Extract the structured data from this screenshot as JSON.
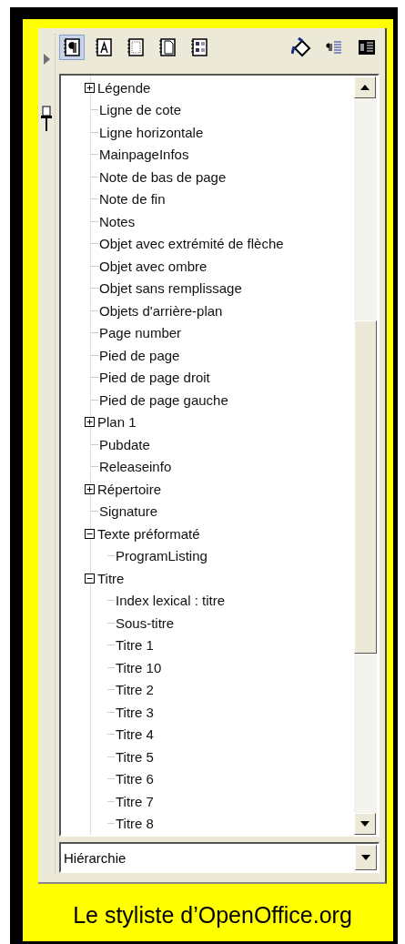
{
  "toolbar": {
    "families": [
      {
        "kind": "paragraph",
        "selected": true
      },
      {
        "kind": "character",
        "selected": false
      },
      {
        "kind": "frame",
        "selected": false
      },
      {
        "kind": "page",
        "selected": false
      },
      {
        "kind": "list",
        "selected": false
      }
    ],
    "actions": [
      {
        "kind": "fill"
      },
      {
        "kind": "new"
      },
      {
        "kind": "update"
      }
    ]
  },
  "tree": [
    {
      "label": "Légende",
      "kind": "group",
      "expanded": false
    },
    {
      "label": "Ligne de cote",
      "kind": "leaf"
    },
    {
      "label": "Ligne horizontale",
      "kind": "leaf"
    },
    {
      "label": "MainpageInfos",
      "kind": "leaf"
    },
    {
      "label": "Note de bas de page",
      "kind": "leaf"
    },
    {
      "label": "Note de fin",
      "kind": "leaf"
    },
    {
      "label": "Notes",
      "kind": "leaf"
    },
    {
      "label": "Objet avec extrémité de flèche",
      "kind": "leaf"
    },
    {
      "label": "Objet avec ombre",
      "kind": "leaf"
    },
    {
      "label": "Objet sans remplissage",
      "kind": "leaf"
    },
    {
      "label": "Objets d'arrière-plan",
      "kind": "leaf"
    },
    {
      "label": "Page number",
      "kind": "leaf"
    },
    {
      "label": "Pied de page",
      "kind": "leaf"
    },
    {
      "label": "Pied de page droit",
      "kind": "leaf"
    },
    {
      "label": "Pied de page gauche",
      "kind": "leaf"
    },
    {
      "label": "Plan 1",
      "kind": "group",
      "expanded": false
    },
    {
      "label": "Pubdate",
      "kind": "leaf"
    },
    {
      "label": "Releaseinfo",
      "kind": "leaf"
    },
    {
      "label": "Répertoire",
      "kind": "group",
      "expanded": false
    },
    {
      "label": "Signature",
      "kind": "leaf"
    },
    {
      "label": "Texte préformaté",
      "kind": "group",
      "expanded": true,
      "children": [
        {
          "label": "ProgramListing"
        }
      ]
    },
    {
      "label": "Titre",
      "kind": "group",
      "expanded": true,
      "children": [
        {
          "label": "Index lexical : titre"
        },
        {
          "label": "Sous-titre"
        },
        {
          "label": "Titre 1"
        },
        {
          "label": "Titre 10"
        },
        {
          "label": "Titre 2"
        },
        {
          "label": "Titre 3"
        },
        {
          "label": "Titre 4"
        },
        {
          "label": "Titre 5"
        },
        {
          "label": "Titre 6"
        },
        {
          "label": "Titre 7"
        },
        {
          "label": "Titre 8"
        }
      ]
    }
  ],
  "filter": {
    "value": "Hiérarchie"
  },
  "caption": "Le styliste d’OpenOffice.org"
}
